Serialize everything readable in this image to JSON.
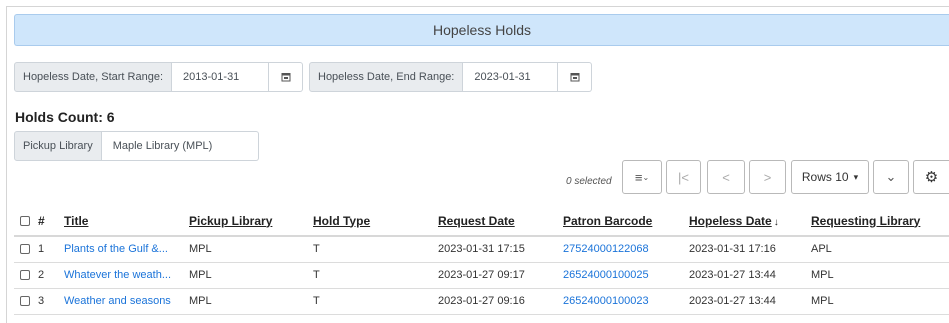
{
  "banner": {
    "title": "Hopeless Holds"
  },
  "filters": {
    "start_label": "Hopeless Date, Start Range:",
    "start_value": "2013-01-31",
    "end_label": "Hopeless Date, End Range:",
    "end_value": "2023-01-31",
    "calendar_icon": "calendar-icon"
  },
  "holds_count": "Holds Count: 6",
  "pickup": {
    "label": "Pickup Library",
    "value": "Maple Library (MPL)"
  },
  "toolbar": {
    "selected_text": "0 selected",
    "sort_icon": "≡",
    "first_page_icon": "|<",
    "prev_icon": "<",
    "next_icon": ">",
    "rows_label": "Rows 10",
    "rows_caret": "▾",
    "expand_icon": "⌄",
    "settings_icon": "⚙"
  },
  "table": {
    "headers": {
      "num": "#",
      "title": "Title",
      "pickup_library": "Pickup Library",
      "hold_type": "Hold Type",
      "request_date": "Request Date",
      "patron_barcode": "Patron Barcode",
      "hopeless_date": "Hopeless Date",
      "hopeless_sort": "↓",
      "requesting_library": "Requesting Library"
    },
    "rows": [
      {
        "num": "1",
        "title": "Plants of the Gulf &...",
        "pickup_library": "MPL",
        "hold_type": "T",
        "request_date": "2023-01-31 17:15",
        "patron_barcode": "27524000122068",
        "hopeless_date": "2023-01-31 17:16",
        "requesting_library": "APL"
      },
      {
        "num": "2",
        "title": "Whatever the weath...",
        "pickup_library": "MPL",
        "hold_type": "T",
        "request_date": "2023-01-27 09:17",
        "patron_barcode": "26524000100025",
        "hopeless_date": "2023-01-27 13:44",
        "requesting_library": "MPL"
      },
      {
        "num": "3",
        "title": "Weather and seasons",
        "pickup_library": "MPL",
        "hold_type": "T",
        "request_date": "2023-01-27 09:16",
        "patron_barcode": "26524000100023",
        "hopeless_date": "2023-01-27 13:44",
        "requesting_library": "MPL"
      }
    ]
  }
}
